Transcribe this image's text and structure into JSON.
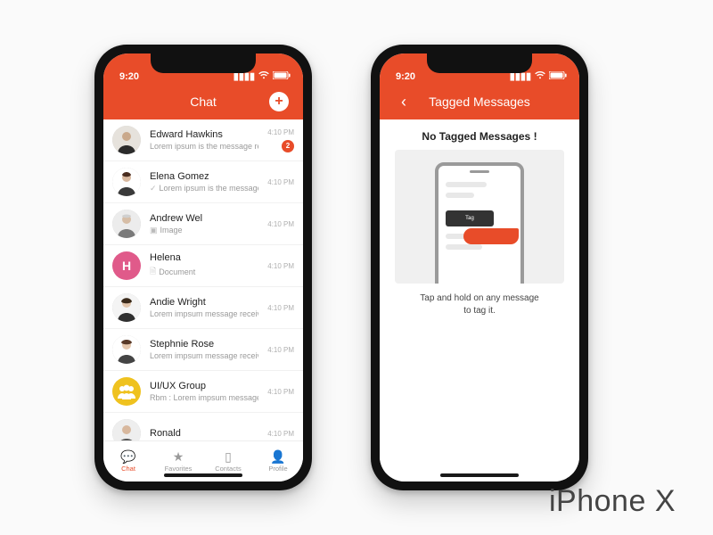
{
  "device_label": "iPhone X",
  "status": {
    "time": "9:20"
  },
  "colors": {
    "accent": "#e84c29"
  },
  "chat_screen": {
    "title": "Chat",
    "rows": [
      {
        "name": "Edward Hawkins",
        "preview": "Lorem ipsum is the message rec…",
        "time": "4:10 PM",
        "unread": "2"
      },
      {
        "name": "Elena Gomez",
        "preview": "Lorem ipsum is the message here",
        "time": "4:10 PM",
        "icon": "check"
      },
      {
        "name": "Andrew Wel",
        "preview": "Image",
        "time": "4:10 PM",
        "icon": "image"
      },
      {
        "name": "Helena",
        "preview": "Document",
        "time": "4:10 PM",
        "icon": "doc",
        "avatar_letter": "H",
        "avatar_color": "#e05a8a"
      },
      {
        "name": "Andie Wright",
        "preview": "Lorem impsum message received",
        "time": "4:10 PM"
      },
      {
        "name": "Stephnie Rose",
        "preview": "Lorem impsum message received",
        "time": "4:10 PM"
      },
      {
        "name": "UI/UX Group",
        "preview": "Rbm : Lorem impsum message received",
        "time": "4:10 PM",
        "avatar_letter": "",
        "avatar_color": "#efc21f",
        "group": true
      },
      {
        "name": "Ronald",
        "preview": "",
        "time": "4:10 PM"
      }
    ],
    "tabs": [
      {
        "label": "Chat",
        "active": true
      },
      {
        "label": "Favorites",
        "active": false
      },
      {
        "label": "Contacts",
        "active": false
      },
      {
        "label": "Profile",
        "active": false
      }
    ]
  },
  "tagged_screen": {
    "title": "Tagged Messages",
    "empty_title": "No Tagged Messages !",
    "empty_caption_l1": "Tap and hold on any message",
    "empty_caption_l2": "to tag it.",
    "tooltip_label": "Tag"
  }
}
